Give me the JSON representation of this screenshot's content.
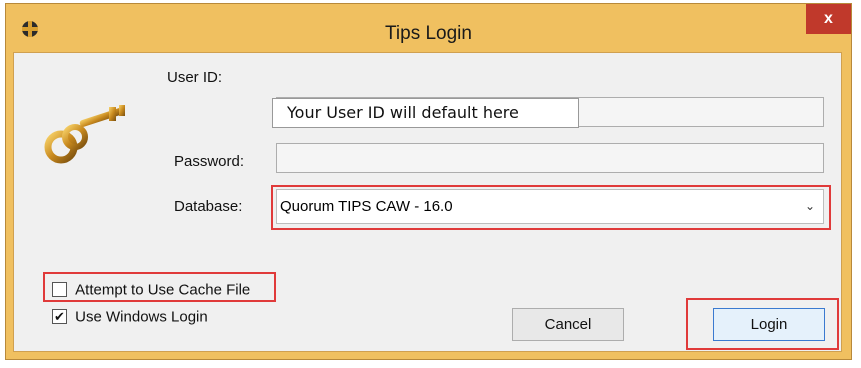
{
  "window": {
    "title": "Tips Login",
    "close_symbol": "x"
  },
  "form": {
    "user_id_label": "User ID:",
    "user_id_value": "",
    "user_id_overlay": "Your User ID will default here",
    "password_label": "Password:",
    "database_label": "Database:",
    "database_value": "Quorum TIPS CAW - 16.0"
  },
  "options": {
    "cache_label": "Attempt to Use Cache File",
    "cache_checked": false,
    "windows_login_label": "Use Windows Login",
    "windows_login_checked": true
  },
  "buttons": {
    "cancel": "Cancel",
    "login": "Login"
  },
  "colors": {
    "frame": "#f0c060",
    "highlight": "#e03a3a",
    "close": "#c0392b"
  },
  "icons": [
    "app-icon",
    "key-icon",
    "close-icon",
    "chevron-down-icon",
    "checkmark-icon"
  ]
}
